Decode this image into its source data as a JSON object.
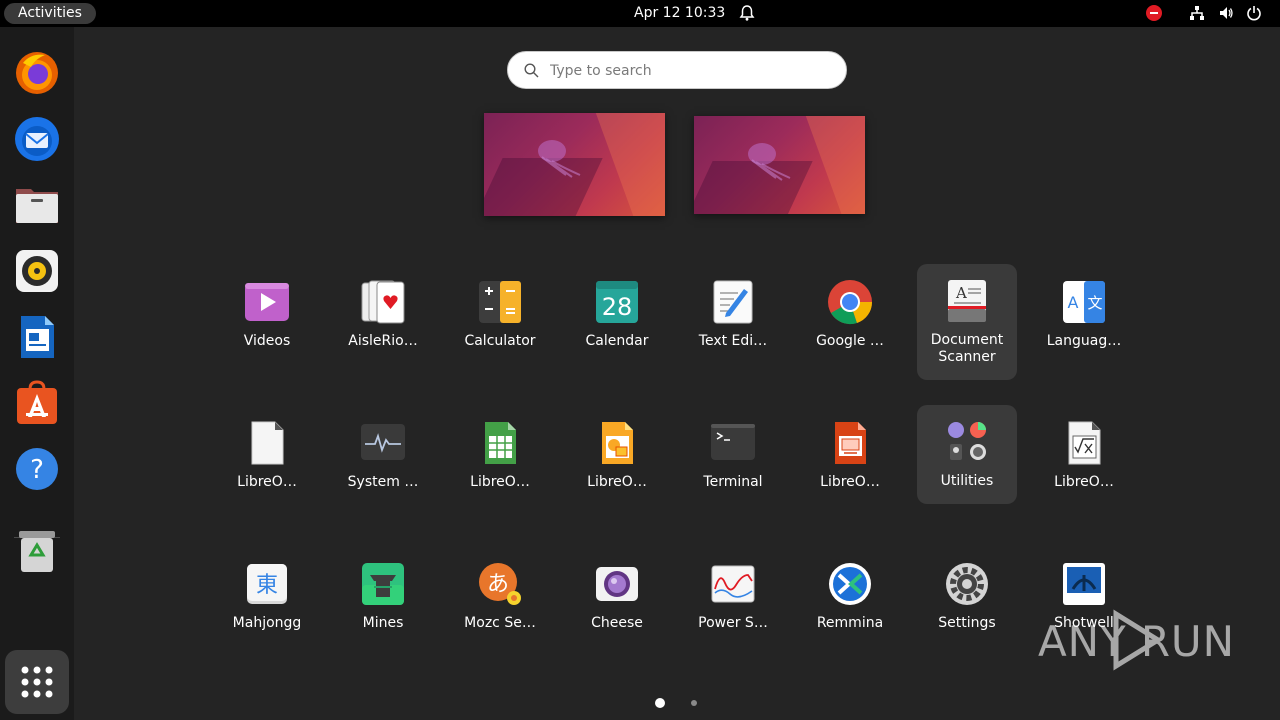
{
  "topbar": {
    "activities_label": "Activities",
    "clock": "Apr 12  10:33"
  },
  "search": {
    "placeholder": "Type to search"
  },
  "dock": {
    "items": [
      "firefox-icon",
      "thunderbird-icon",
      "files-icon",
      "rhythmbox-icon",
      "writer-icon",
      "app-center-icon",
      "help-icon",
      "trash-icon"
    ]
  },
  "app_grid": {
    "rows": [
      [
        {
          "label": "Videos",
          "icon": "videos-icon"
        },
        {
          "label": "AisleRio…",
          "icon": "aisleriot-icon"
        },
        {
          "label": "Calculator",
          "icon": "calculator-icon"
        },
        {
          "label": "Calendar",
          "icon": "calendar-icon",
          "icon_text": "28"
        },
        {
          "label": "Text Edi…",
          "icon": "text-editor-icon"
        },
        {
          "label": "Google …",
          "icon": "chrome-icon"
        },
        {
          "label": "Document\nScanner",
          "icon": "document-scanner-icon",
          "highlighted": true
        },
        {
          "label": "Languag…",
          "icon": "language-icon"
        }
      ],
      [
        {
          "label": "LibreO…",
          "icon": "libreoffice-icon"
        },
        {
          "label": "System …",
          "icon": "system-monitor-icon"
        },
        {
          "label": "LibreO…",
          "icon": "libreoffice-calc-icon"
        },
        {
          "label": "LibreO…",
          "icon": "libreoffice-draw-icon"
        },
        {
          "label": "Terminal",
          "icon": "terminal-icon"
        },
        {
          "label": "LibreO…",
          "icon": "libreoffice-impress-icon"
        },
        {
          "label": "Utilities",
          "icon": "utilities-folder-icon",
          "highlighted": true
        },
        {
          "label": "LibreO…",
          "icon": "libreoffice-math-icon"
        }
      ],
      [
        {
          "label": "Mahjongg",
          "icon": "mahjongg-icon",
          "icon_text": "東"
        },
        {
          "label": "Mines",
          "icon": "mines-icon"
        },
        {
          "label": "Mozc Se…",
          "icon": "mozc-icon",
          "icon_text": "あ"
        },
        {
          "label": "Cheese",
          "icon": "cheese-icon"
        },
        {
          "label": "Power S…",
          "icon": "power-statistics-icon"
        },
        {
          "label": "Remmina",
          "icon": "remmina-icon"
        },
        {
          "label": "Settings",
          "icon": "settings-icon"
        },
        {
          "label": "Shotwell",
          "icon": "shotwell-icon"
        }
      ]
    ]
  },
  "pager": {
    "pages": 2,
    "current": 1
  },
  "watermark": {
    "text": "ANY RUN"
  }
}
